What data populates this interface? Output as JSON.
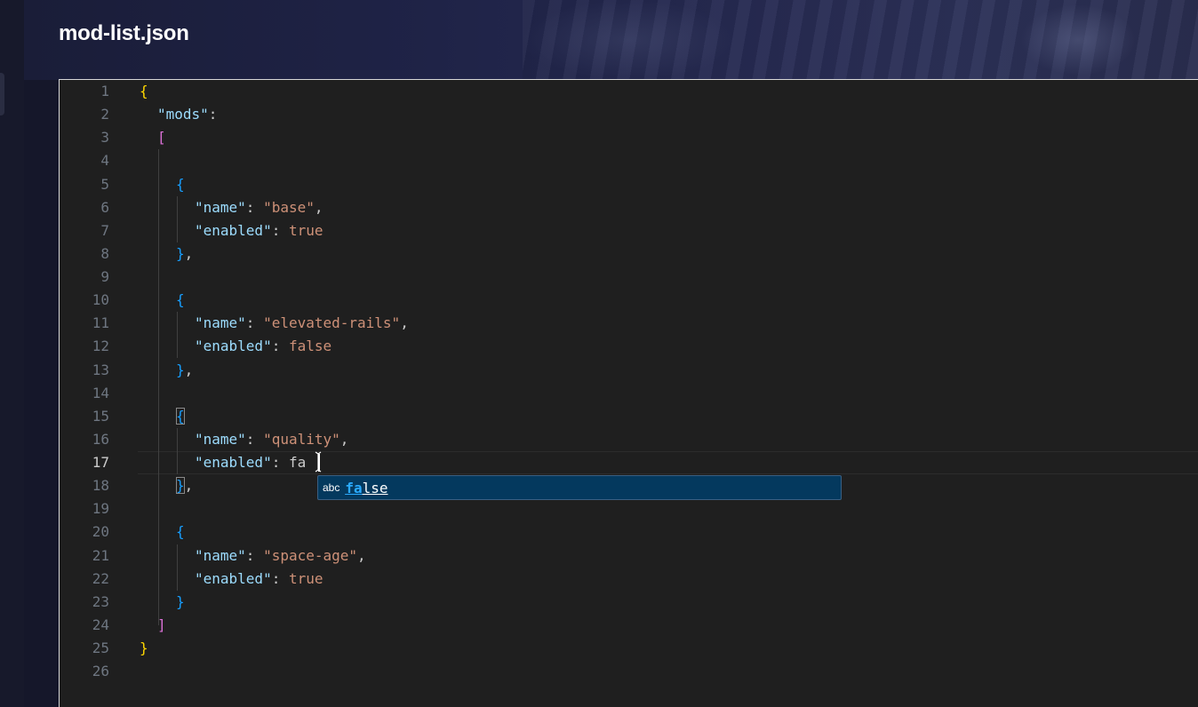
{
  "window": {
    "title": "mod-list.json"
  },
  "editor": {
    "active_line": 17,
    "line_numbers": [
      "1",
      "2",
      "3",
      "4",
      "5",
      "6",
      "7",
      "8",
      "9",
      "10",
      "11",
      "12",
      "13",
      "14",
      "15",
      "16",
      "17",
      "18",
      "19",
      "20",
      "21",
      "22",
      "23",
      "24",
      "25",
      "26"
    ],
    "code": {
      "l1_brace": "{",
      "l2_key": "\"mods\"",
      "l2_colon": ":",
      "l3_bracket": "[",
      "l5_brace": "{",
      "l6_key": "\"name\"",
      "l6_colon": ": ",
      "l6_val": "\"base\"",
      "l6_comma": ",",
      "l7_key": "\"enabled\"",
      "l7_colon": ": ",
      "l7_val": "true",
      "l8_brace": "}",
      "l8_comma": ",",
      "l10_brace": "{",
      "l11_key": "\"name\"",
      "l11_colon": ": ",
      "l11_val": "\"elevated-rails\"",
      "l11_comma": ",",
      "l12_key": "\"enabled\"",
      "l12_colon": ": ",
      "l12_val": "false",
      "l13_brace": "}",
      "l13_comma": ",",
      "l15_brace": "{",
      "l16_key": "\"name\"",
      "l16_colon": ": ",
      "l16_val": "\"quality\"",
      "l16_comma": ",",
      "l17_key": "\"enabled\"",
      "l17_colon": ": ",
      "l17_typed": "fa",
      "l18_brace": "}",
      "l18_comma": ",",
      "l20_brace": "{",
      "l21_key": "\"name\"",
      "l21_colon": ": ",
      "l21_val": "\"space-age\"",
      "l21_comma": ",",
      "l22_key": "\"enabled\"",
      "l22_colon": ": ",
      "l22_val": "true",
      "l23_brace": "}",
      "l24_bracket": "]",
      "l25_brace": "}"
    },
    "suggestion": {
      "kind_label": "abc",
      "match": "fa",
      "rest": "lse"
    }
  },
  "colors": {
    "editor_bg": "#1f1f1f",
    "key": "#9cdcfe",
    "string": "#ce9178",
    "bracket_level1": "#ffd700",
    "bracket_level2": "#da70d6",
    "bracket_level3": "#179fff",
    "suggest_bg": "#04395e"
  }
}
